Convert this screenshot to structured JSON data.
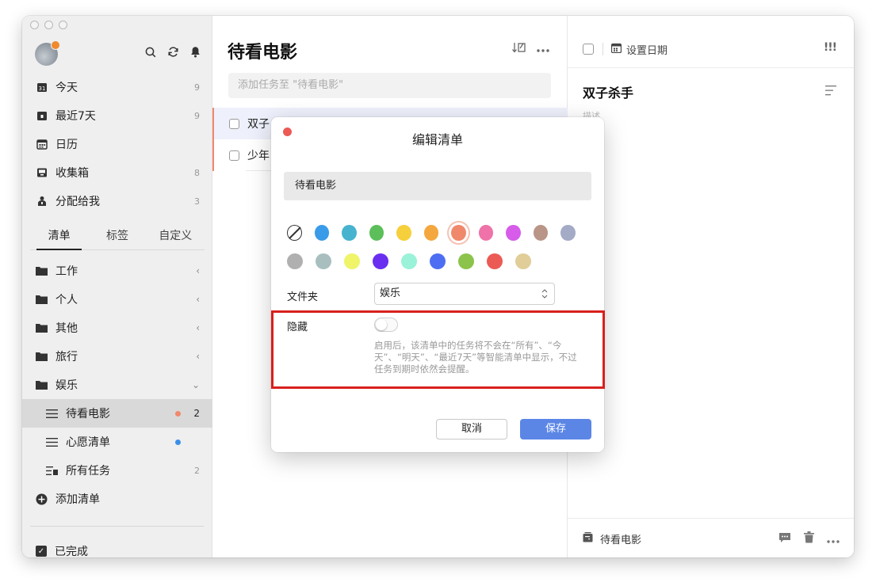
{
  "sidebar": {
    "smart_lists": [
      {
        "label": "今天",
        "count": "9",
        "icon": "calendar-today-icon"
      },
      {
        "label": "最近7天",
        "count": "9",
        "icon": "calendar-week-icon"
      },
      {
        "label": "日历",
        "count": "",
        "icon": "calendar-icon"
      },
      {
        "label": "收集箱",
        "count": "8",
        "icon": "inbox-icon"
      },
      {
        "label": "分配给我",
        "count": "3",
        "icon": "assigned-icon"
      }
    ],
    "tabs": [
      "清单",
      "标签",
      "自定义"
    ],
    "folders": [
      {
        "label": "工作",
        "chevron": "‹"
      },
      {
        "label": "个人",
        "chevron": "‹"
      },
      {
        "label": "其他",
        "chevron": "‹"
      },
      {
        "label": "旅行",
        "chevron": "‹"
      },
      {
        "label": "娱乐",
        "chevron": "⌄"
      }
    ],
    "lists": [
      {
        "label": "待看电影",
        "count": "2",
        "dot_color": "#f0886c"
      },
      {
        "label": "心愿清单",
        "count": "",
        "dot_color": "#3a8fe8"
      },
      {
        "label": "所有任务",
        "count": "2",
        "dot_color": ""
      }
    ],
    "add_list": "添加清单",
    "completed": "已完成"
  },
  "middle": {
    "title": "待看电影",
    "add_placeholder": "添加任务至 \"待看电影\"",
    "tasks": [
      "双子",
      "少年"
    ]
  },
  "detail": {
    "set_date": "设置日期",
    "priority": "!!!",
    "title": "双子杀手",
    "description_placeholder": "描述",
    "footer_list": "待看电影"
  },
  "modal": {
    "title": "编辑清单",
    "name_value": "待看电影",
    "colors_row1": [
      "none",
      "#3a9be8",
      "#47b3cf",
      "#5cbf5a",
      "#f6cf3c",
      "#f4a73e",
      "#f0886c",
      "#ef72a8",
      "#d65ce9",
      "#b99587",
      "#a3abc6"
    ],
    "colors_row2": [
      "#b0b0b0",
      "#a9bfbf",
      "#eff468",
      "#6a2ef0",
      "#9af2d8",
      "#4d6ef2",
      "#8cc34b",
      "#ec5a55",
      "#e0cd98"
    ],
    "selected_color": "#f0886c",
    "folder_label": "文件夹",
    "folder_value": "娱乐",
    "hide_label": "隐藏",
    "hide_hint": "启用后，该清单中的任务将不会在“所有”、“今天”、“明天”、“最近7天”等智能清单中显示，不过任务到期时依然会提醒。",
    "cancel": "取消",
    "save": "保存"
  }
}
